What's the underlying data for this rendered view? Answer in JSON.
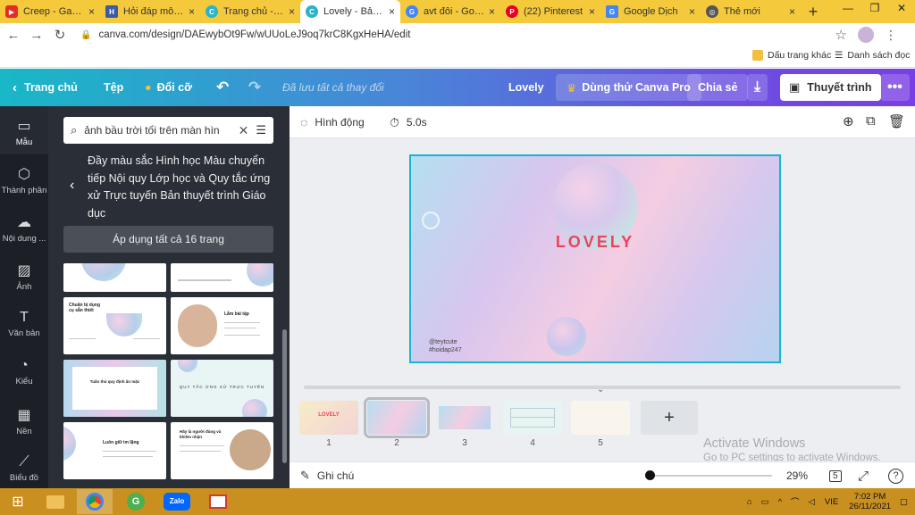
{
  "browser": {
    "tabs": [
      {
        "title": "Creep - Gampe",
        "color": "#e52d27"
      },
      {
        "title": "Hỏi đáp môn A",
        "color": "#3b5ba9"
      },
      {
        "title": "Trang chủ - Ca",
        "color": "#2ab3c9"
      },
      {
        "title": "Lovely - Bản th",
        "color": "#2ab3c9"
      },
      {
        "title": "avt đôi - Googl",
        "color": "#4285f4"
      },
      {
        "title": "(22) Pinterest",
        "color": "#e60023"
      },
      {
        "title": "Google Dịch",
        "color": "#4285f4"
      },
      {
        "title": "Thẻ mới",
        "color": "#555555"
      }
    ],
    "url": "canva.com/design/DAEwybOt9Fw/wUUoLeJ9oq7krC8KgxHeHA/edit",
    "bookmarks": [
      "Dấu trang khác",
      "Danh sách đọc"
    ]
  },
  "header": {
    "home": "Trang chủ",
    "file": "Tệp",
    "resize": "Đổi cỡ",
    "saved": "Đã lưu tất cả thay đổi",
    "design_name": "Lovely",
    "try_pro": "Dùng thử Canva Pro",
    "share": "Chia sẻ",
    "present": "Thuyết trình"
  },
  "rail": [
    "Mẫu",
    "Thành phần",
    "Nội dung ...",
    "Ảnh",
    "Văn bản",
    "Kiểu",
    "Nền",
    "Biểu đồ"
  ],
  "panel": {
    "search_value": "ảnh bầu trời tối trên màn hìn",
    "title": "Đầy màu sắc Hình học Màu chuyển tiếp Nội quy Lớp học và Quy tắc ứng xử Trực tuyến Bản thuyết trình Giáo dục",
    "apply": "Áp dụng tất cả 16 trang",
    "thumb_texts": {
      "t1": "Chuẩn bị dụng cụ sẵn thiết",
      "t2": "Lắm bài tập",
      "t3": "Tuân thủ quy định ăn mặc",
      "t4": "QUY TẮC ỨNG XỬ TRỰC TUYẾN",
      "t5": "Luôn giữ im lặng",
      "t6": "Hãy là người đúng và khiêm nhận"
    }
  },
  "editor": {
    "animate": "Hình động",
    "duration": "5.0s",
    "slide_title": "LOVELY",
    "handle_1": "@teytcute",
    "handle_2": "#hoidap247",
    "pages": [
      "1",
      "2",
      "3",
      "4",
      "5"
    ],
    "notes": "Ghi chú",
    "zoom": "29%",
    "page_count": "5",
    "watermark_1": "Activate Windows",
    "watermark_2": "Go to PC settings to activate Windows.",
    "thumb1_title": "LOVELY"
  },
  "taskbar": {
    "lang": "VIE",
    "time": "7:02 PM",
    "date": "26/11/2021",
    "zalo": "Zalo"
  },
  "colors": {
    "taskbar": "#c9901f",
    "tabbar": "#f5c93c",
    "accent": "#19b4d2",
    "title_red": "#e8455d"
  }
}
